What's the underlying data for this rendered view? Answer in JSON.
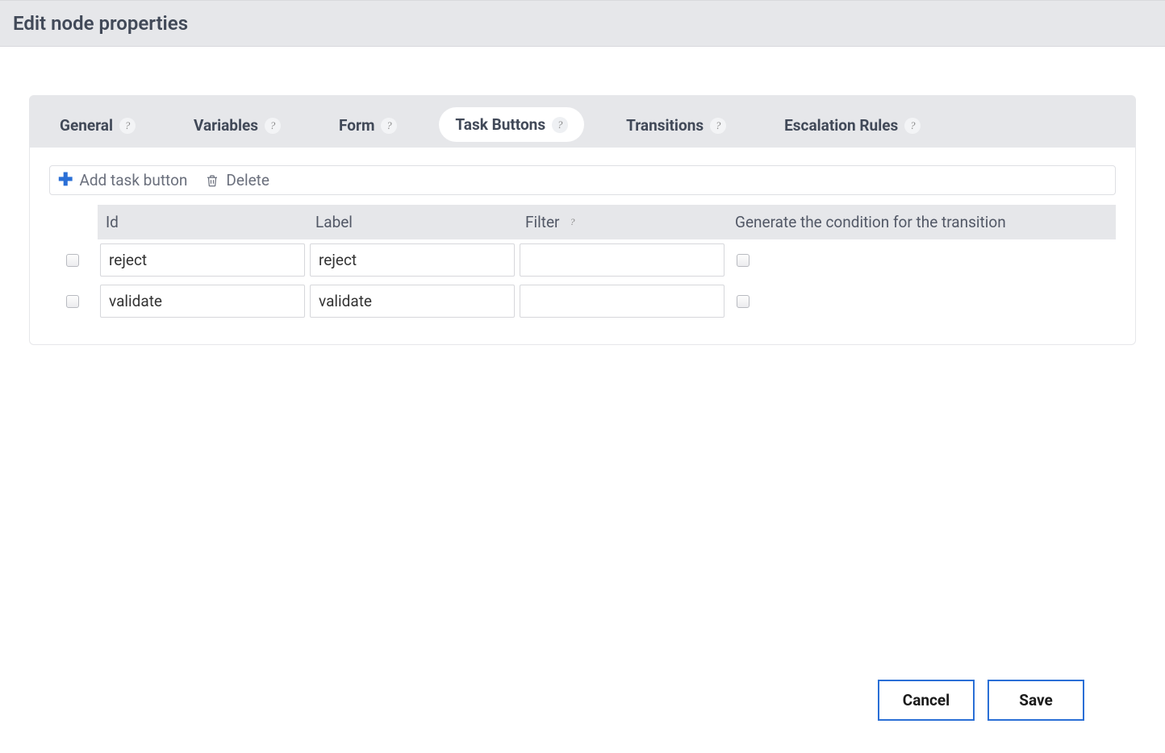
{
  "header": {
    "title": "Edit node properties"
  },
  "tabs": [
    {
      "label": "General"
    },
    {
      "label": "Variables"
    },
    {
      "label": "Form"
    },
    {
      "label": "Task Buttons",
      "active": true
    },
    {
      "label": "Transitions"
    },
    {
      "label": "Escalation Rules"
    }
  ],
  "toolbar": {
    "add_label": "Add task button",
    "delete_label": "Delete"
  },
  "table": {
    "headers": {
      "id": "Id",
      "label": "Label",
      "filter": "Filter",
      "condition": "Generate the condition for the transition"
    },
    "rows": [
      {
        "id": "reject",
        "label": "reject",
        "filter": "",
        "generate_condition": false
      },
      {
        "id": "validate",
        "label": "validate",
        "filter": "",
        "generate_condition": false
      }
    ]
  },
  "footer": {
    "cancel": "Cancel",
    "save": "Save"
  },
  "help_glyph": "?"
}
